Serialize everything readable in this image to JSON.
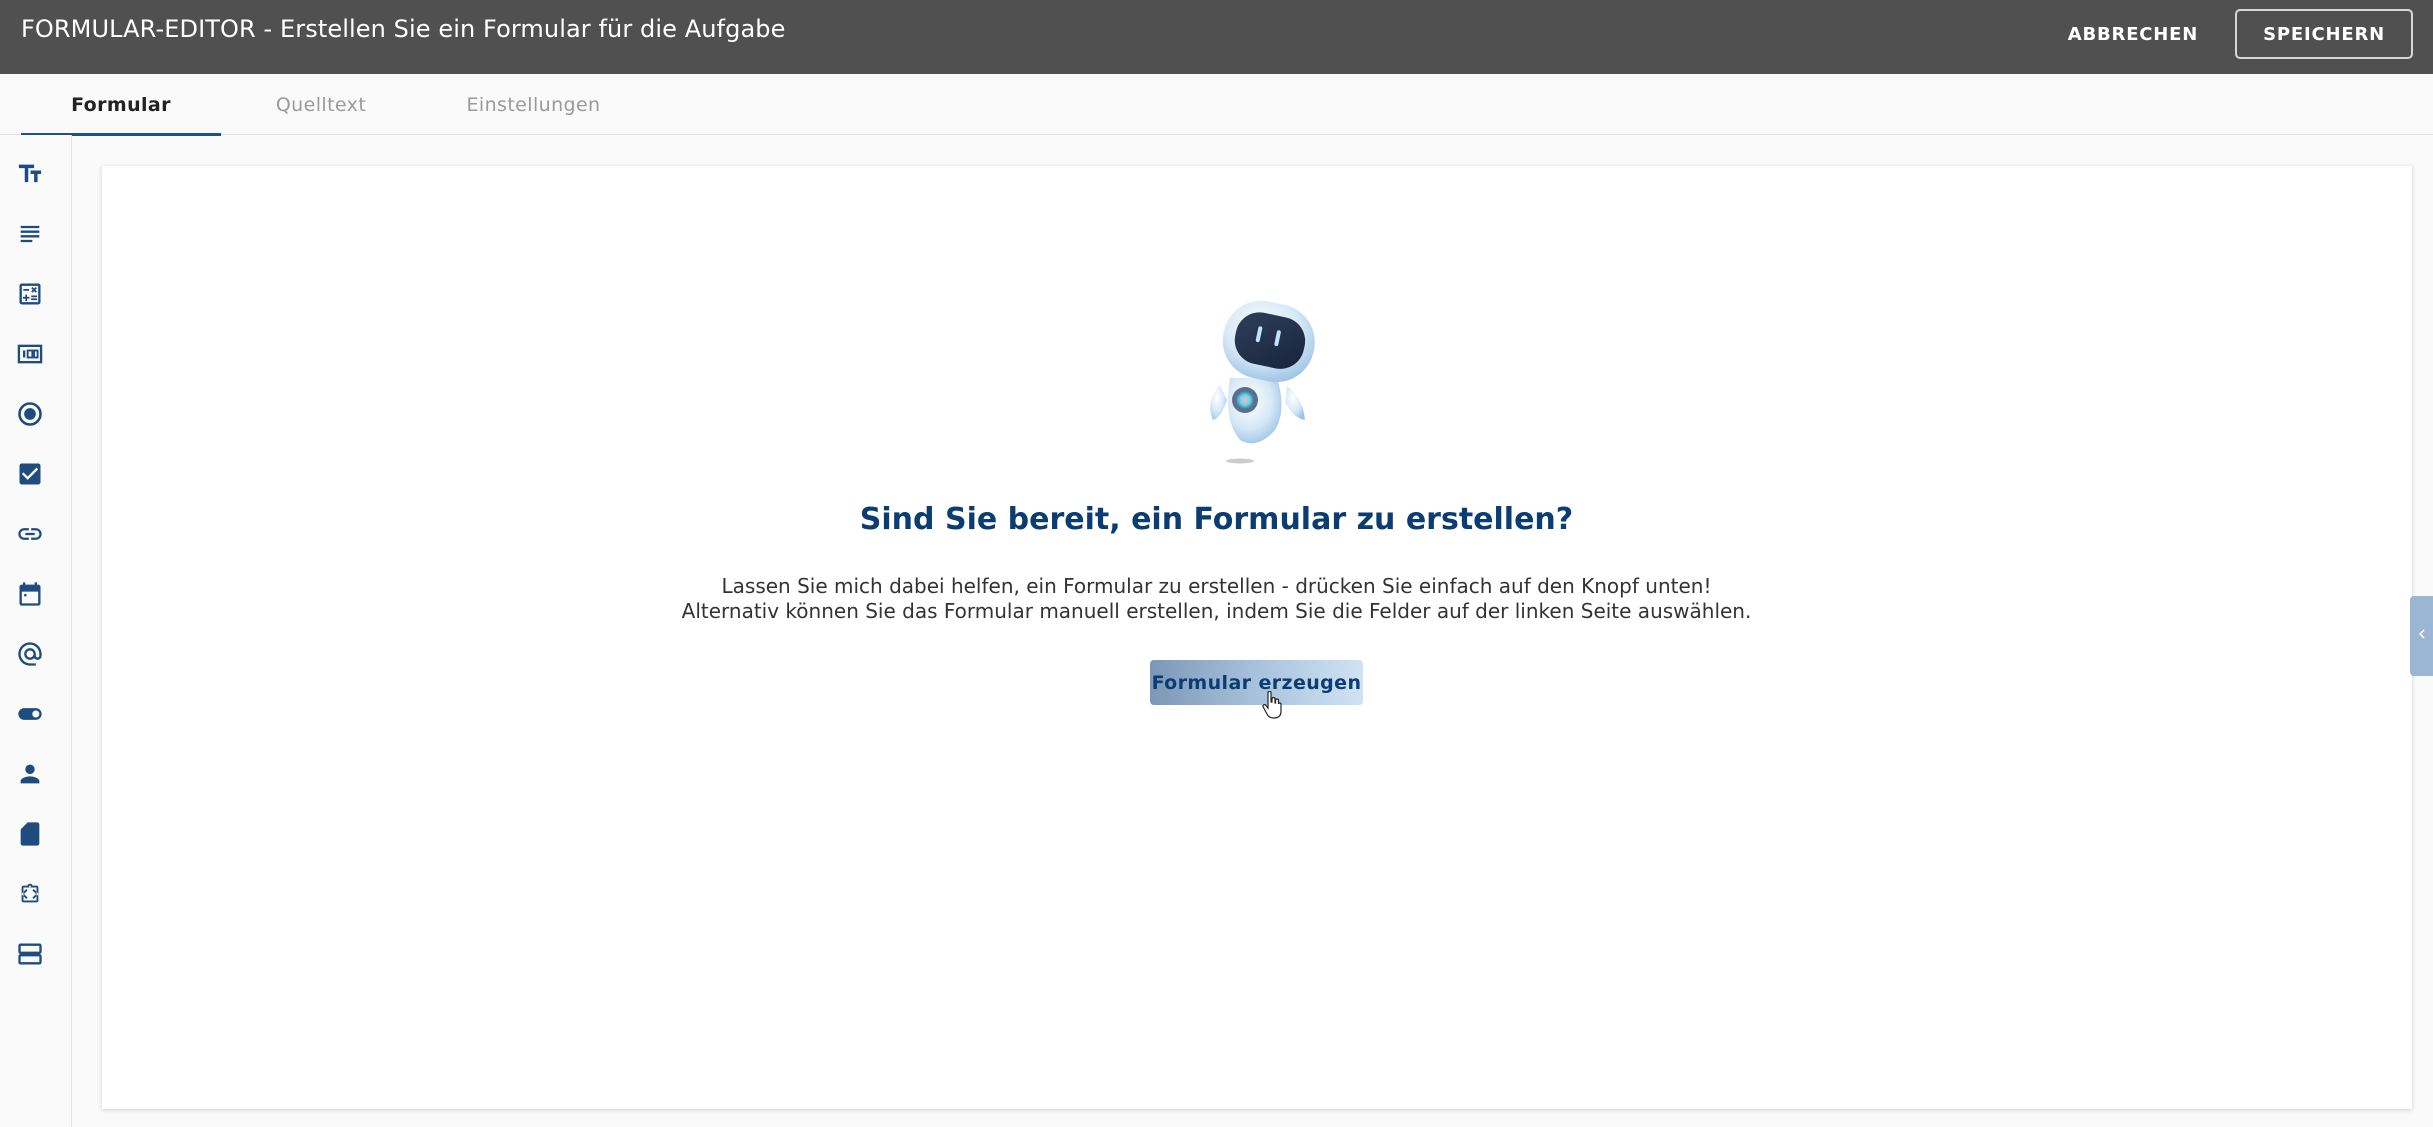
{
  "header": {
    "title": "FORMULAR-EDITOR - Erstellen Sie ein Formular für die Aufgabe",
    "cancel_label": "ABBRECHEN",
    "save_label": "SPEICHERN"
  },
  "tabs": [
    {
      "label": "Formular",
      "active": true
    },
    {
      "label": "Quelltext",
      "active": false
    },
    {
      "label": "Einstellungen",
      "active": false
    }
  ],
  "sidebar": {
    "items": [
      {
        "icon": "text-fields-icon"
      },
      {
        "icon": "textarea-icon"
      },
      {
        "icon": "calculator-icon"
      },
      {
        "icon": "number-field-icon"
      },
      {
        "icon": "radio-button-icon"
      },
      {
        "icon": "checkbox-icon"
      },
      {
        "icon": "link-icon"
      },
      {
        "icon": "calendar-icon"
      },
      {
        "icon": "email-icon"
      },
      {
        "icon": "toggle-icon"
      },
      {
        "icon": "person-icon"
      },
      {
        "icon": "document-icon"
      },
      {
        "icon": "code-icon"
      },
      {
        "icon": "storage-icon"
      }
    ]
  },
  "main": {
    "headline": "Sind Sie bereit, ein Formular zu erstellen?",
    "line1": "Lassen Sie mich dabei helfen, ein Formular zu erstellen - drücken Sie einfach auf den Knopf unten!",
    "line2": "Alternativ können Sie das Formular manuell erstellen, indem Sie die Felder auf der linken Seite auswählen.",
    "generate_label": "Formular erzeugen"
  },
  "colors": {
    "header_bg": "#505050",
    "primary": "#0b3d72",
    "icon": "#1f4c7f",
    "tab_indicator": "#1f5088"
  }
}
